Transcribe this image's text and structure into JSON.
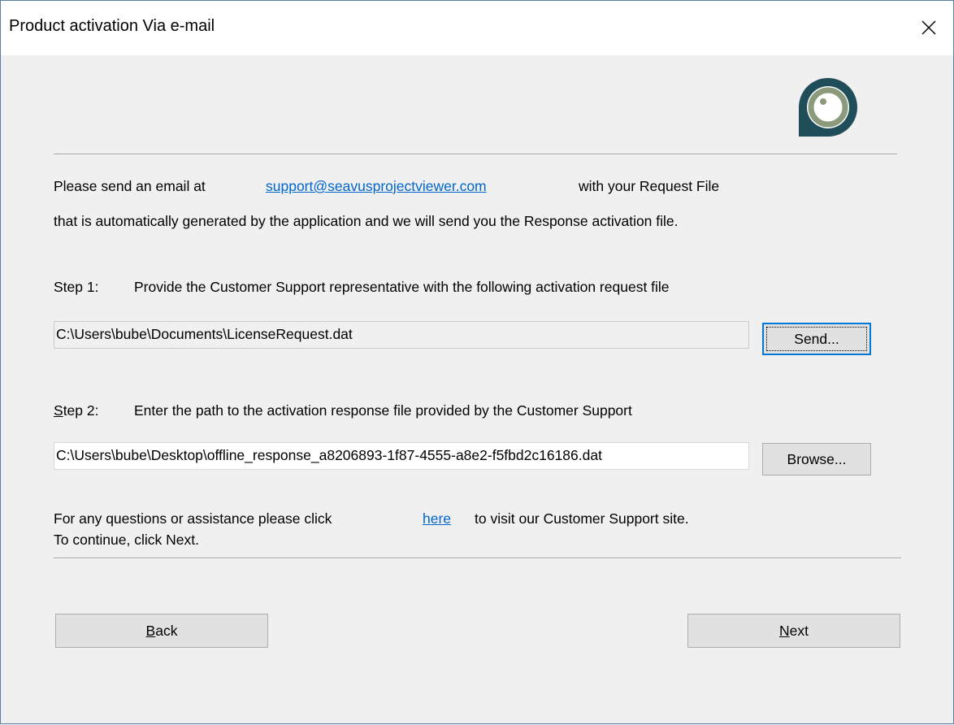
{
  "window": {
    "title": "Product activation Via e-mail"
  },
  "intro": {
    "line1_prefix": "Please send an email at",
    "email_link": "support@seavusprojectviewer.com",
    "line1_suffix": "with your Request File",
    "line2": "that is automatically generated by the application and we will send you the Response activation file."
  },
  "step1": {
    "label": "Step 1:",
    "description": "Provide the Customer Support representative with the following activation request file",
    "path_value": "C:\\Users\\bube\\Documents\\LicenseRequest.dat",
    "send_label": "Send..."
  },
  "step2": {
    "label_first_letter": "S",
    "label_rest": "tep 2:",
    "description": "Enter the path to the activation response file provided by the Customer Support",
    "path_value": "C:\\Users\\bube\\Desktop\\offline_response_a8206893-1f87-4555-a8e2-f5fbd2c16186.dat",
    "browse_label": "Browse..."
  },
  "footer": {
    "help_prefix": "For any questions or assistance please click",
    "help_link": "here",
    "help_suffix": "to visit our Customer Support site.",
    "continue_text": "To continue, click Next."
  },
  "nav": {
    "back_first_letter": "B",
    "back_rest": "ack",
    "next_first_letter": "N",
    "next_rest": "ext"
  },
  "colors": {
    "accent": "#0078d7",
    "link": "#0066cc",
    "logo_dark": "#1f4e5a",
    "logo_ring": "#8a9a7b"
  }
}
